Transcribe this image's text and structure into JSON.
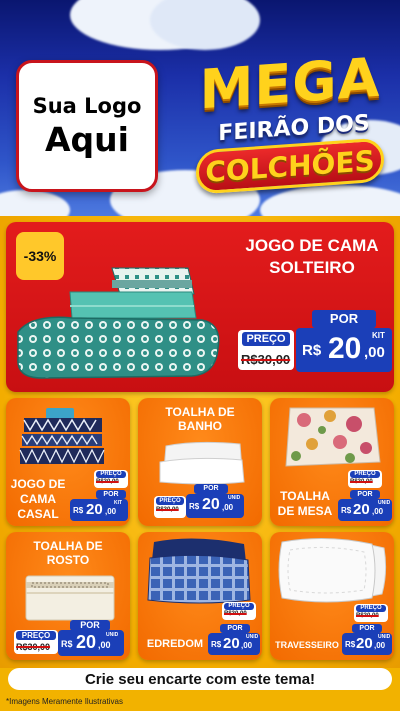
{
  "logo": {
    "line1": "Sua Logo",
    "line2": "Aqui"
  },
  "headline": {
    "mega": "MEGA",
    "feirao": "FEIRÃO DOS",
    "colchoes": "COLCHÕES"
  },
  "colors": {
    "red": "#e31c1c",
    "orange": "#f26a00",
    "yellow": "#ffd21c",
    "blue": "#1b3fb8",
    "navy": "#0a1670"
  },
  "featured": {
    "discount": "-33%",
    "title_line1": "JOGO DE CAMA",
    "title_line2": "SOLTEIRO",
    "preco_label": "PREÇO",
    "old_price": "R$30,00",
    "por_label": "POR",
    "currency": "R$",
    "price_int": "20",
    "price_dec": ",00",
    "unit": "KIT"
  },
  "products": [
    {
      "title_line1": "JOGO DE",
      "title_line2": "CAMA",
      "title_line3": "CASAL",
      "preco_label": "PREÇO",
      "old_price": "R$30,00",
      "por_label": "POR",
      "currency": "R$",
      "price_int": "20",
      "price_dec": ",00",
      "unit": "KIT"
    },
    {
      "title_line1": "TOALHA DE",
      "title_line2": "BANHO",
      "preco_label": "PREÇO",
      "old_price": "R$30,00",
      "por_label": "POR",
      "currency": "R$",
      "price_int": "20",
      "price_dec": ",00",
      "unit": "UNID"
    },
    {
      "title_line1": "TOALHA",
      "title_line2": "DE MESA",
      "preco_label": "PREÇO",
      "old_price": "R$30,00",
      "por_label": "POR",
      "currency": "R$",
      "price_int": "20",
      "price_dec": ",00",
      "unit": "UNID"
    },
    {
      "title_line1": "TOALHA DE",
      "title_line2": "ROSTO",
      "preco_label": "PREÇO",
      "old_price": "R$30,00",
      "por_label": "POR",
      "currency": "R$",
      "price_int": "20",
      "price_dec": ",00",
      "unit": "UNID"
    },
    {
      "title_line1": "EDREDOM",
      "preco_label": "PREÇO",
      "old_price": "R$30,00",
      "por_label": "POR",
      "currency": "R$",
      "price_int": "20",
      "price_dec": ",00",
      "unit": "UNID"
    },
    {
      "title_line1": "TRAVESSEIRO",
      "preco_label": "PREÇO",
      "old_price": "R$30,00",
      "por_label": "POR",
      "currency": "R$",
      "price_int": "20",
      "price_dec": ",00",
      "unit": "UNID"
    }
  ],
  "cta": "Crie seu encarte com este tema!",
  "disclaimer": "*Imagens Meramente Ilustrativas"
}
